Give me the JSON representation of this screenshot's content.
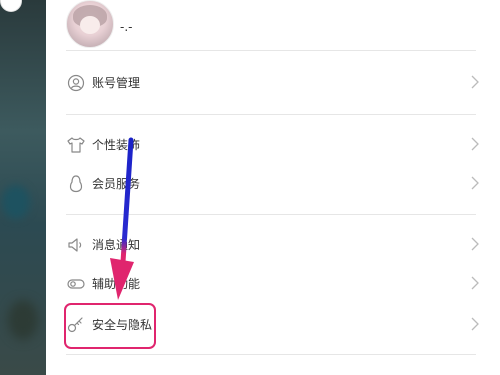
{
  "profile": {
    "nickname": "-.-"
  },
  "menu": [
    {
      "label": "账号管理",
      "icon": "account-icon"
    },
    {
      "label": "个性装饰",
      "icon": "tshirt-icon"
    },
    {
      "label": "会员服务",
      "icon": "penguin-icon"
    },
    {
      "label": "消息通知",
      "icon": "speaker-icon"
    },
    {
      "label": "辅助功能",
      "icon": "toggle-icon"
    },
    {
      "label": "安全与隐私",
      "icon": "key-icon"
    }
  ],
  "annotation": {
    "arrow_colors": [
      "#1a22c8",
      "#e0256e"
    ],
    "highlight_color": "#e0256e",
    "highlighted_item": "安全与隐私"
  },
  "colors": {
    "text": "#333333",
    "divider": "#e6e6e6",
    "icon": "#888888"
  }
}
